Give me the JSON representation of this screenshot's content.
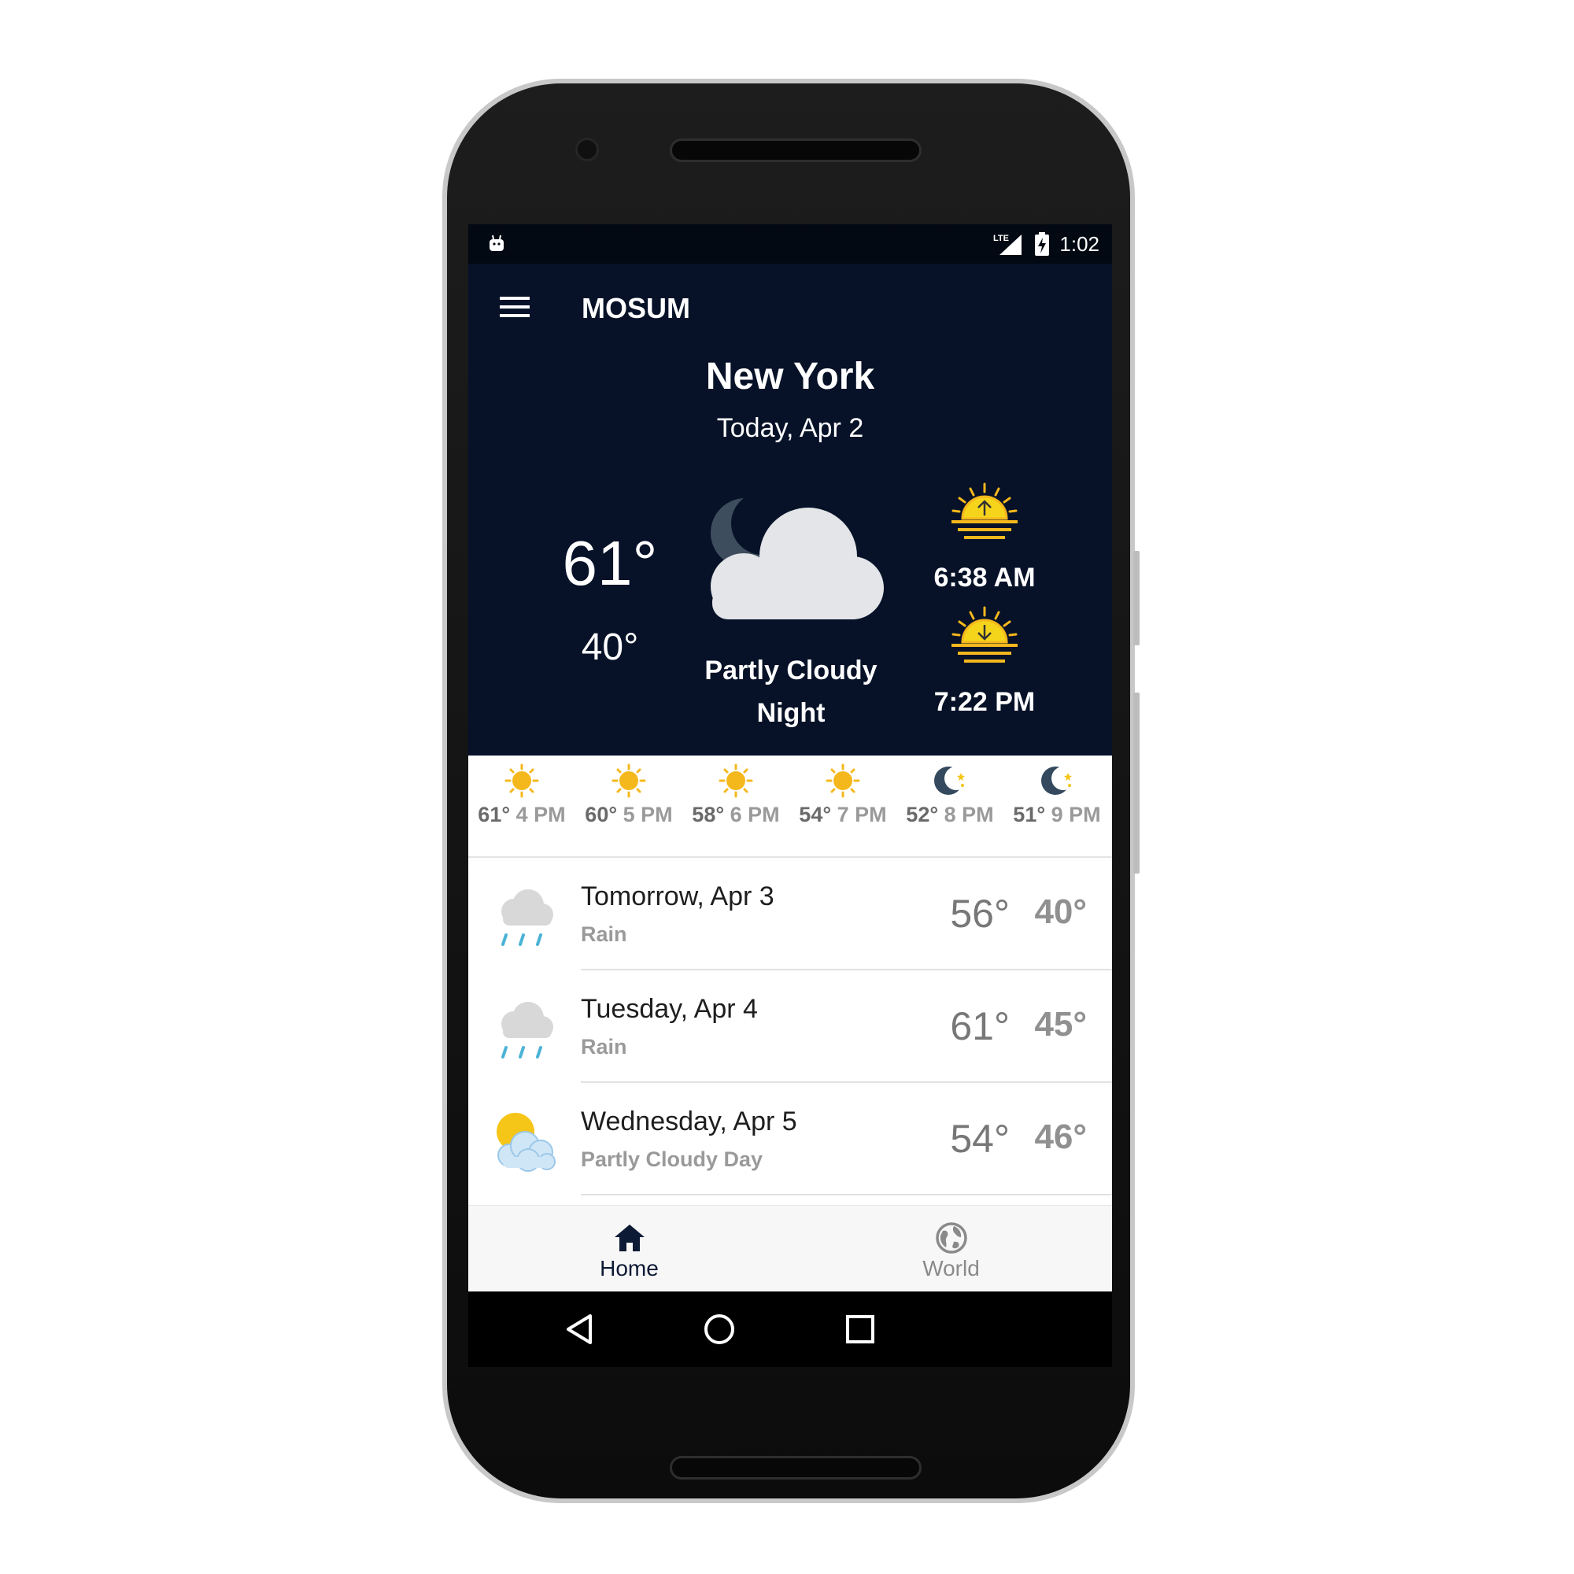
{
  "status_bar": {
    "time": "1:02",
    "network_label": "LTE",
    "icons": [
      "android-debug-icon",
      "lte-signal-icon",
      "battery-charging-icon"
    ]
  },
  "app_bar": {
    "title": "MOSUM",
    "menu_icon": "hamburger-menu-icon"
  },
  "today": {
    "city": "New York",
    "date": "Today, Apr 2",
    "high": "61°",
    "low": "40°",
    "condition_line1": "Partly Cloudy",
    "condition_line2": "Night",
    "icon": "partly-cloudy-night-icon",
    "sunrise": "6:38 AM",
    "sunset": "7:22 PM"
  },
  "hourly": [
    {
      "temp": "61°",
      "time": "4 PM",
      "icon": "sun-icon"
    },
    {
      "temp": "60°",
      "time": "5 PM",
      "icon": "sun-icon"
    },
    {
      "temp": "58°",
      "time": "6 PM",
      "icon": "sun-icon"
    },
    {
      "temp": "54°",
      "time": "7 PM",
      "icon": "sun-icon"
    },
    {
      "temp": "52°",
      "time": "8 PM",
      "icon": "moon-stars-icon"
    },
    {
      "temp": "51°",
      "time": "9 PM",
      "icon": "moon-stars-icon"
    }
  ],
  "daily": [
    {
      "day": "Tomorrow, Apr 3",
      "condition": "Rain",
      "high": "56°",
      "low": "40°",
      "icon": "rain-cloud-icon"
    },
    {
      "day": "Tuesday, Apr 4",
      "condition": "Rain",
      "high": "61°",
      "low": "45°",
      "icon": "rain-cloud-icon"
    },
    {
      "day": "Wednesday, Apr 5",
      "condition": "Partly Cloudy Day",
      "high": "54°",
      "low": "46°",
      "icon": "partly-cloudy-day-icon"
    }
  ],
  "bottom_nav": [
    {
      "label": "Home",
      "icon": "home-icon",
      "active": true
    },
    {
      "label": "World",
      "icon": "globe-icon",
      "active": false
    }
  ],
  "colors": {
    "app_bar": "#071228",
    "status_bar": "#020912",
    "sun": "#f5b81c",
    "rain": "#4ab3d6",
    "nav_active": "#0d1a35",
    "nav_inactive": "#8a8a8a"
  }
}
